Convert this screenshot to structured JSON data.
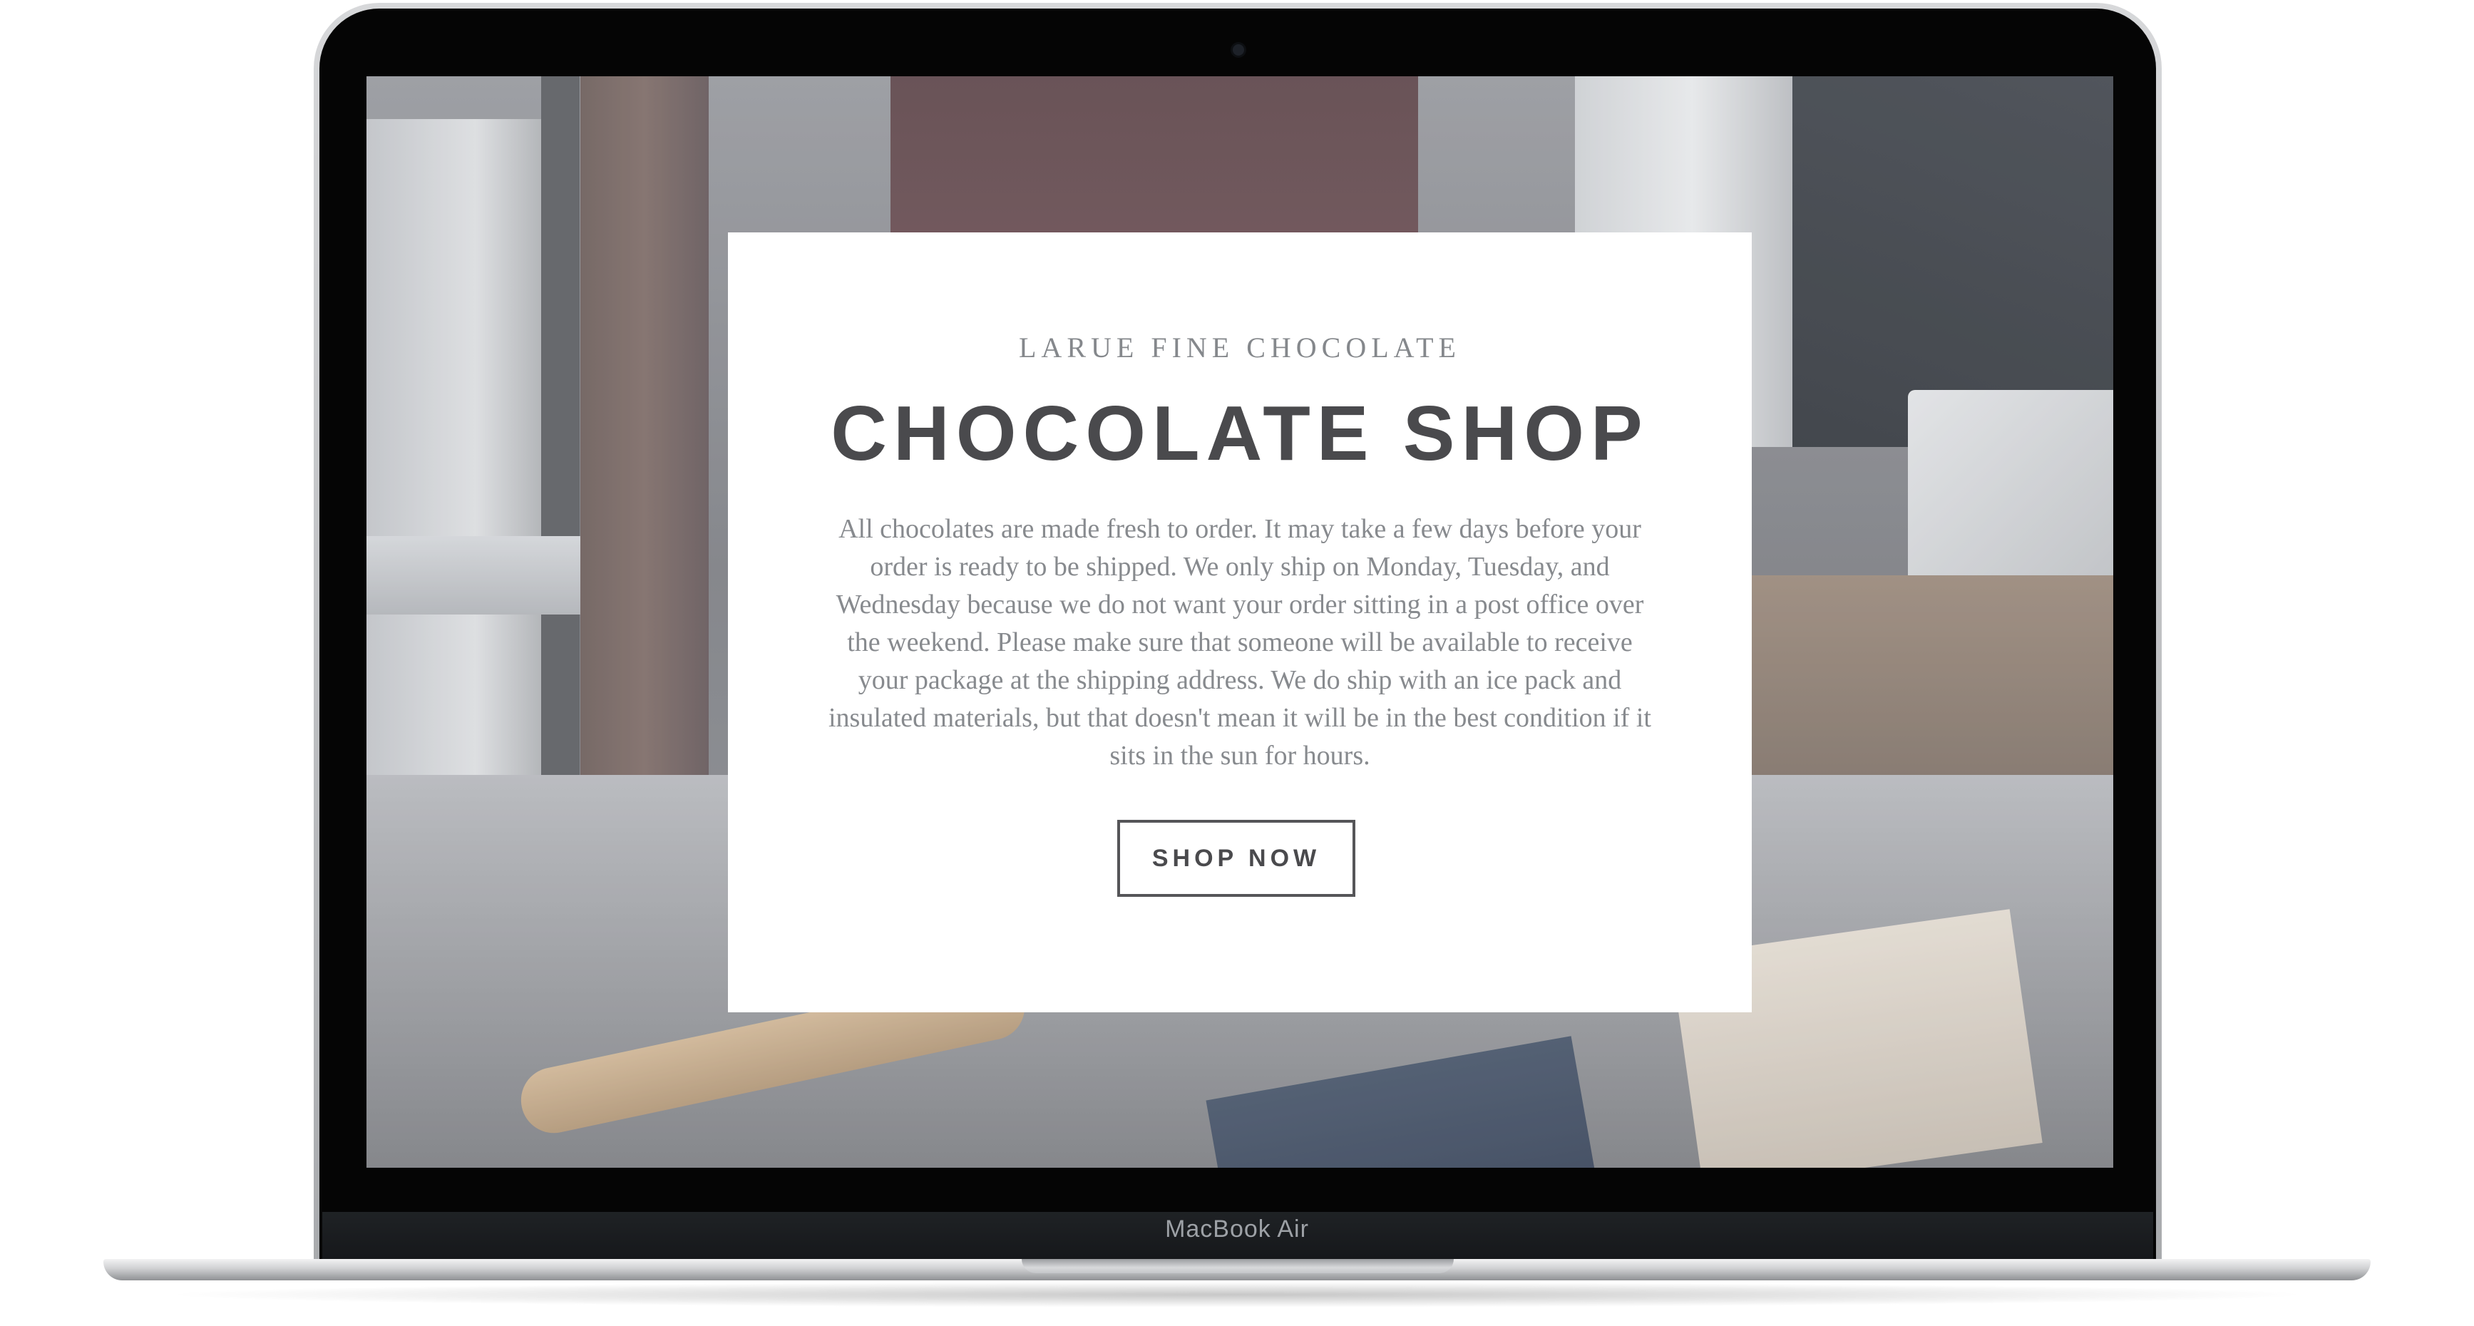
{
  "device": {
    "brand_label": "MacBook Air"
  },
  "hero": {
    "kicker": "LARUE FINE CHOCOLATE",
    "title": "CHOCOLATE SHOP",
    "body": "All chocolates are made fresh to order. It may take a few days before your order is ready to be shipped. We only ship on Monday, Tuesday, and Wednesday because we do not want your order sitting in a post office over the weekend. Please make sure that someone will be available to receive your package at the shipping address. We do ship with an ice pack and insulated materials, but that doesn't mean it will be in the best condition if it sits in the sun for hours.",
    "cta_label": "SHOP NOW"
  },
  "colors": {
    "heading": "#4a4a4d",
    "body_text": "#878a8e",
    "card_background": "#ffffff",
    "button_border": "#555558"
  }
}
